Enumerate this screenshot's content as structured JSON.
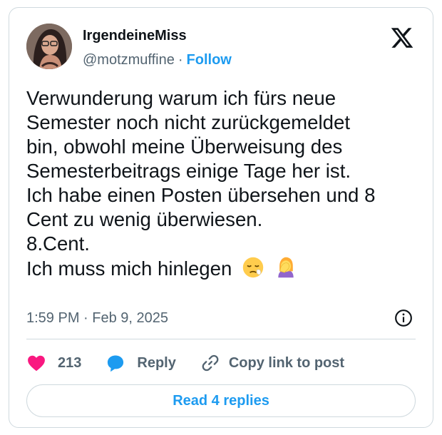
{
  "author": {
    "display_name": "IrgendeineMiss",
    "handle": "@motzmuffine",
    "separator": "·",
    "follow_label": "Follow"
  },
  "tweet": {
    "lines": [
      "Verwunderung warum ich fürs neue",
      "Semester noch nicht zurückgemeldet",
      "bin, obwohl meine Überweisung des",
      "Semesterbeitrags einige Tage her ist.",
      "Ich habe einen Posten übersehen und 8",
      "Cent zu wenig überwiesen.",
      "8.Cent.",
      "Ich muss mich hinlegen"
    ],
    "emojis": [
      "sleepy-face-emoji",
      "woman-facepalming-emoji"
    ],
    "timestamp": "1:59 PM · Feb 9, 2025"
  },
  "actions": {
    "like_count": "213",
    "reply_label": "Reply",
    "copy_label": "Copy link to post"
  },
  "read_replies_label": "Read 4 replies",
  "colors": {
    "accent": "#1d9bf0",
    "like": "#f91880",
    "text": "#0f1419",
    "muted": "#536471",
    "border": "#cfd9de"
  }
}
